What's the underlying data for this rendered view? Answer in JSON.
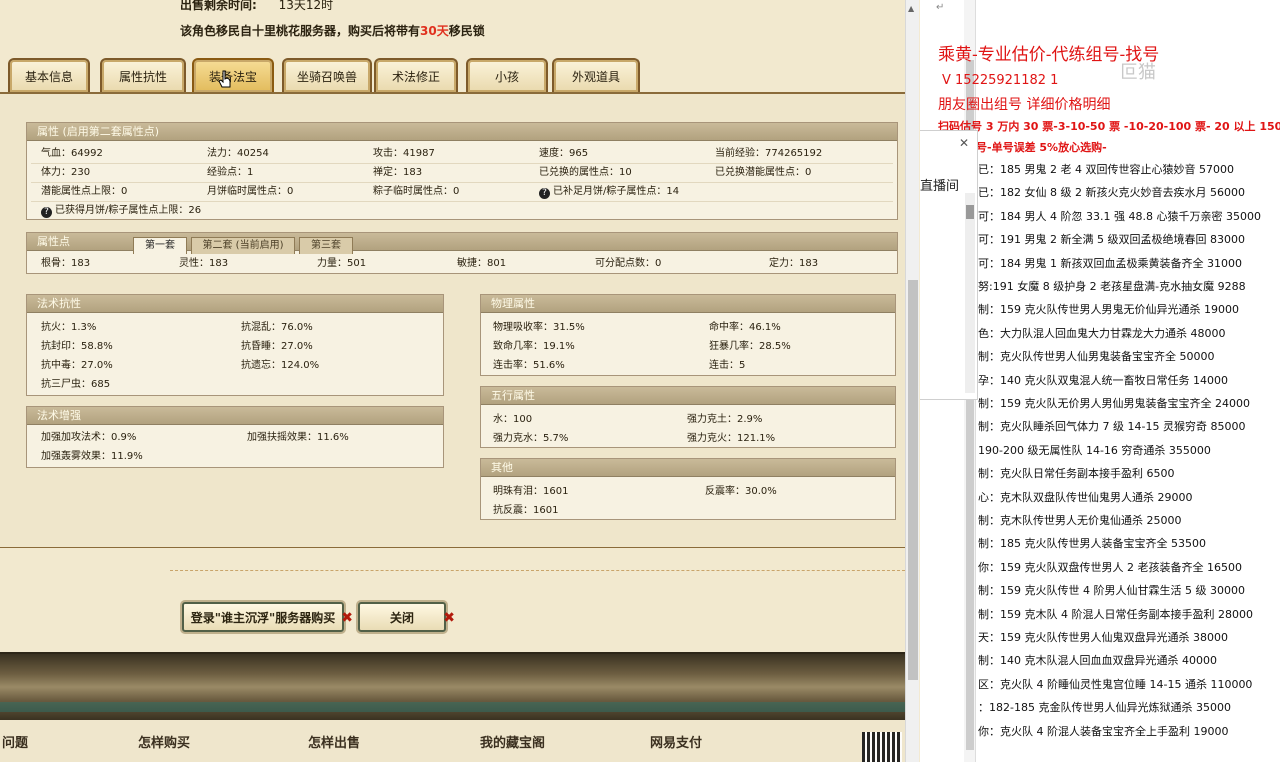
{
  "header": {
    "remaining_label": "出售剩余时间:",
    "remaining_value": "13天12时",
    "notice_prefix": "该角色移民自十里桃花服务器，购买后将带有",
    "notice_days": "30天",
    "notice_suffix": "移民锁"
  },
  "tabs": [
    {
      "label": "基本信息"
    },
    {
      "label": "属性抗性"
    },
    {
      "label": "装备法宝"
    },
    {
      "label": "坐骑召唤兽"
    },
    {
      "label": "术法修正"
    },
    {
      "label": "小孩"
    },
    {
      "label": "外观道具"
    }
  ],
  "attributes": {
    "title": "属性 (启用第二套属性点)",
    "rows": [
      [
        "气血：64992",
        "法力：40254",
        "攻击：41987",
        "速度：965",
        "当前经验：774265192"
      ],
      [
        "体力：230",
        "经验点：1",
        "禅定：183",
        "已兑换的属性点：10",
        "已兑换潜能属性点：0"
      ],
      [
        "潜能属性点上限：0",
        "月饼临时属性点：0",
        "粽子临时属性点：0",
        "已补足月饼/粽子属性点：14",
        ""
      ]
    ],
    "footnote": "已获得月饼/粽子属性点上限：26"
  },
  "points": {
    "title": "属性点",
    "subtabs": [
      "第一套",
      "第二套 (当前启用)",
      "第三套"
    ],
    "row": [
      "根骨：183",
      "灵性：183",
      "力量：501",
      "敏捷：801",
      "可分配点数：0",
      "定力：183"
    ]
  },
  "resist": {
    "title": "法术抗性",
    "rows": [
      [
        "抗火：1.3%",
        "抗混乱：76.0%"
      ],
      [
        "抗封印：58.8%",
        "抗昏睡：27.0%"
      ],
      [
        "抗中毒：27.0%",
        "抗遗忘：124.0%"
      ],
      [
        "抗三尸虫：685",
        ""
      ]
    ]
  },
  "enhance": {
    "title": "法术增强",
    "rows": [
      [
        "加强加攻法术：0.9%",
        "加强扶摇效果：11.6%"
      ],
      [
        "加强轰雾效果：11.9%",
        ""
      ]
    ]
  },
  "physical": {
    "title": "物理属性",
    "rows": [
      [
        "物理吸收率：31.5%",
        "命中率：46.1%"
      ],
      [
        "致命几率：19.1%",
        "狂暴几率：28.5%"
      ],
      [
        "连击率：51.6%",
        "连击：5"
      ]
    ]
  },
  "wuxing": {
    "title": "五行属性",
    "rows": [
      [
        "水：100",
        "强力克土：2.9%"
      ],
      [
        "强力克水：5.7%",
        "强力克火：121.1%"
      ]
    ]
  },
  "other": {
    "title": "其他",
    "rows": [
      [
        "明珠有泪：1601",
        "反震率：30.0%"
      ],
      [
        "抗反震：1601",
        ""
      ]
    ]
  },
  "buttons": {
    "buy": "登录\"谁主沉浮\"服务器购买",
    "close": "关闭"
  },
  "footer": [
    "问题",
    "怎样购买",
    "怎样出售",
    "我的藏宝阁",
    "网易支付"
  ],
  "doc": {
    "title": "乘黄-专业估价-代练组号-找号",
    "phone": "V 15225921182   1",
    "watermark": "叵猫",
    "friends": "朋友圈出组号    详细价格明细",
    "rule": "扫码估号 3 万内 30 票-3-10-50 票  -10-20-100 票- 20 以上 150",
    "rule2": "号-单号误差 5%放心选购-",
    "popup_text": "直播间",
    "listings": [
      "已：185 男鬼 2 老 4 双回传世容止心猿妙音 57000",
      "已：182 女仙 8 级 2 新孩火克火妙音去疾水月 56000",
      "可：184 男人 4 阶忽 33.1 强 48.8 心猿千万亲密 35000",
      "可：191 男鬼 2 新全满 5 级双回孟极绝境春回 83000",
      "可：184 男鬼 1 新孩双回血孟极乘黄装备齐全 31000",
      "努:191 女魔 8 级护身 2 老孩星盘满-克水抽女魔 9288",
      "制：159 克火队传世男人男鬼无价仙异光通杀 19000",
      "色：大力队混人回血鬼大力甘霖龙大力通杀 48000",
      "制：克火队传世男人仙男鬼装备宝宝齐全 50000",
      "孕：140 克火队双鬼混人统一畜牧日常任务 14000",
      "制：159 克火队无价男人男仙男鬼装备宝宝齐全 24000",
      "制：克火队睡杀回气体力 7 级 14-15 灵猴穷奇 85000",
      "190-200 级无属性队 14-16 穷奇通杀 355000",
      "制：克火队日常任务副本接手盈利 6500",
      "心：克木队双盘队传世仙鬼男人通杀 29000",
      "制：克木队传世男人无价鬼仙通杀 25000",
      "制：185 克火队传世男人装备宝宝齐全 53500",
      "你：159 克火队双盘传世男人 2 老孩装备齐全 16500",
      "制：159 克火队传世 4 阶男人仙甘霖生活 5 级 30000",
      "制：159 克木队 4 阶混人日常任务副本接手盈利 28000",
      "天：159 克火队传世男人仙鬼双盘异光通杀 38000",
      "制：140 克木队混人回血血双盘异光通杀 40000",
      "区：克火队 4 阶睡仙灵性鬼宫位睡 14-15 通杀 110000",
      "：182-185 克金队传世男人仙异光炼狱通杀 35000",
      "你：克火队 4 阶混人装备宝宝齐全上手盈利 19000"
    ]
  }
}
